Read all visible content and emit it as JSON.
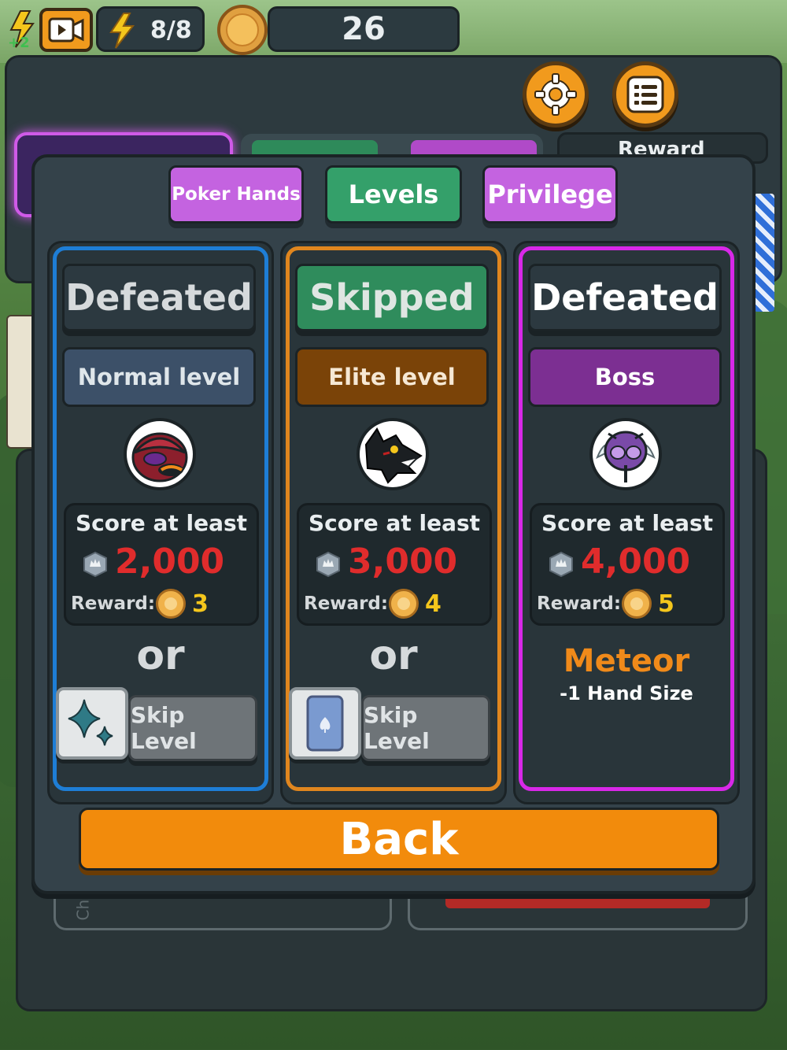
{
  "hud": {
    "energy": "8/8",
    "gold": "26"
  },
  "behind": {
    "reward_label": "Reward",
    "side_label": "Cha"
  },
  "tabs": [
    {
      "label": "Poker Hands"
    },
    {
      "label": "Levels"
    },
    {
      "label": "Privilege"
    }
  ],
  "levels": [
    {
      "status": "Defeated",
      "type": "Normal level",
      "score_label": "Score at least",
      "score": "2,000",
      "reward_label": "Reward:",
      "reward": "3",
      "or": "or",
      "skip_label": "Skip Level",
      "accent": "#1e7ed6"
    },
    {
      "status": "Skipped",
      "type": "Elite level",
      "score_label": "Score at least",
      "score": "3,000",
      "reward_label": "Reward:",
      "reward": "4",
      "or": "or",
      "skip_label": "Skip Level",
      "accent": "#e0861e"
    },
    {
      "status": "Defeated",
      "type": "Boss",
      "score_label": "Score at least",
      "score": "4,000",
      "reward_label": "Reward:",
      "reward": "5",
      "boss_power": "Meteor",
      "boss_effect": "-1 Hand Size",
      "accent": "#d828e8"
    }
  ],
  "back_label": "Back"
}
